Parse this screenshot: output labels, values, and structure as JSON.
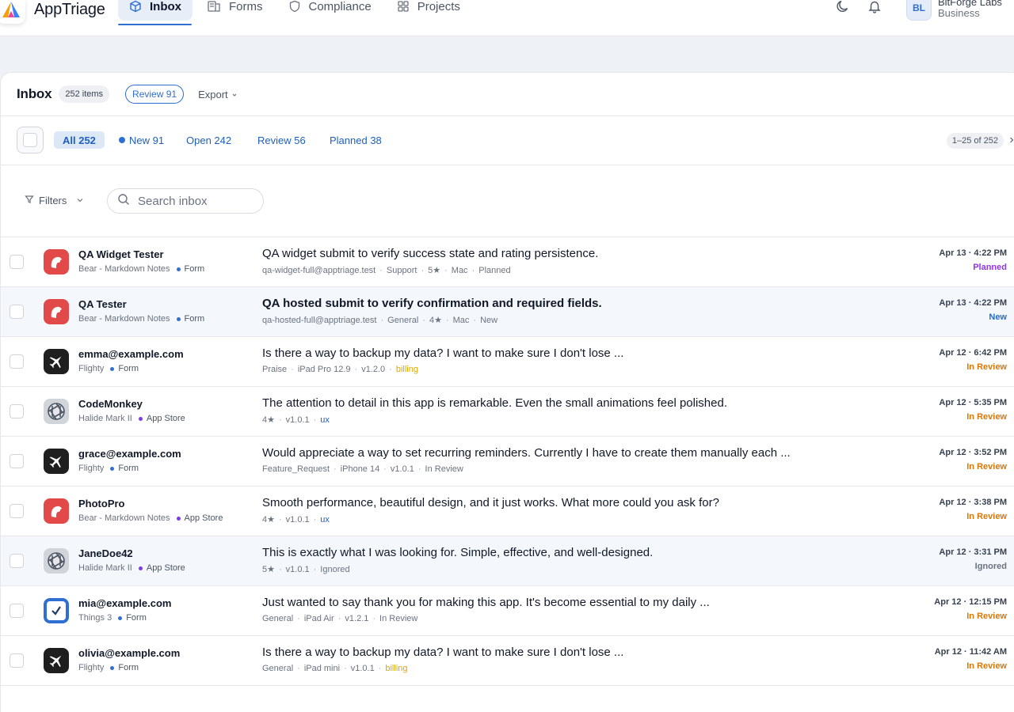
{
  "app": {
    "brand": "AppTriage"
  },
  "nav": {
    "items": [
      {
        "label": "Inbox",
        "icon": "inbox-icon",
        "active": true
      },
      {
        "label": "Forms",
        "icon": "forms-icon",
        "active": false
      },
      {
        "label": "Compliance",
        "icon": "shield-icon",
        "active": false
      },
      {
        "label": "Projects",
        "icon": "grid-icon",
        "active": false
      }
    ]
  },
  "account": {
    "initials": "BL",
    "org_name": "BitForge Labs",
    "plan": "Business"
  },
  "inbox": {
    "title": "Inbox",
    "count_badge": "252 items",
    "review_button": "Review 91",
    "export_label": "Export"
  },
  "tabs": [
    {
      "label": "All 252",
      "active": true,
      "dot": false
    },
    {
      "label": "New 91",
      "active": false,
      "dot": true
    },
    {
      "label": "Open 242",
      "active": false,
      "dot": false
    },
    {
      "label": "Review 56",
      "active": false,
      "dot": false
    },
    {
      "label": "Planned 38",
      "active": false,
      "dot": false
    }
  ],
  "pager": {
    "range": "1–25 of 252"
  },
  "filters": {
    "label": "Filters",
    "search_placeholder": "Search inbox"
  },
  "colors": {
    "accent": "#2f6fd1",
    "status_planned": "#9333ea",
    "status_new": "#1f6fd1",
    "status_in_review": "#d97706",
    "status_ignored": "#6b7280",
    "source_form": "#2f6fd1",
    "source_app_store": "#7c3aed",
    "tag_billing": "#e0a800",
    "tag_ux": "#1f5fbf"
  },
  "rows": [
    {
      "name": "QA Widget Tester",
      "app": "Bear - Markdown Notes",
      "app_icon": "bear-icon",
      "source": "Form",
      "message": "QA widget submit to verify success state and rating persistence.",
      "bold": false,
      "meta": [
        "qa-widget-full@apptriage.test",
        "Support",
        "5★",
        "Mac",
        "Planned"
      ],
      "date": "Apr 13 · 4:22 PM",
      "status": "Planned"
    },
    {
      "name": "QA Tester",
      "app": "Bear - Markdown Notes",
      "app_icon": "bear-icon",
      "source": "Form",
      "message": "QA hosted submit to verify confirmation and required fields.",
      "bold": true,
      "meta": [
        "qa-hosted-full@apptriage.test",
        "General",
        "4★",
        "Mac",
        "New"
      ],
      "date": "Apr 13 · 4:22 PM",
      "status": "New"
    },
    {
      "name": "emma@example.com",
      "app": "Flighty",
      "app_icon": "plane-icon",
      "source": "Form",
      "message": "Is there a way to backup my data? I want to make sure I don't lose ...",
      "bold": false,
      "meta": [
        "Praise",
        "iPad Pro 12.9",
        "v1.2.0",
        "billing"
      ],
      "date": "Apr 12 · 6:42 PM",
      "status": "In Review"
    },
    {
      "name": "CodeMonkey",
      "app": "Halide Mark II",
      "app_icon": "aperture-icon",
      "source": "App Store",
      "message": "The attention to detail in this app is remarkable. Even the small animations feel polished.",
      "bold": false,
      "meta": [
        "4★",
        "v1.0.1",
        "ux"
      ],
      "date": "Apr 12 · 5:35 PM",
      "status": "In Review"
    },
    {
      "name": "grace@example.com",
      "app": "Flighty",
      "app_icon": "plane-icon",
      "source": "Form",
      "message": "Would appreciate a way to set recurring reminders. Currently I have to create them manually each ...",
      "bold": false,
      "meta": [
        "Feature_Request",
        "iPhone 14",
        "v1.0.1",
        "In Review"
      ],
      "date": "Apr 12 · 3:52 PM",
      "status": "In Review"
    },
    {
      "name": "PhotoPro",
      "app": "Bear - Markdown Notes",
      "app_icon": "bear-icon",
      "source": "App Store",
      "message": "Smooth performance, beautiful design, and it just works. What more could you ask for?",
      "bold": false,
      "meta": [
        "4★",
        "v1.0.1",
        "ux"
      ],
      "date": "Apr 12 · 3:38 PM",
      "status": "In Review"
    },
    {
      "name": "JaneDoe42",
      "app": "Halide Mark II",
      "app_icon": "aperture-icon",
      "source": "App Store",
      "message": "This is exactly what I was looking for. Simple, effective, and well-designed.",
      "bold": false,
      "meta": [
        "5★",
        "v1.0.1",
        "Ignored"
      ],
      "date": "Apr 12 · 3:31 PM",
      "status": "Ignored"
    },
    {
      "name": "mia@example.com",
      "app": "Things 3",
      "app_icon": "checkbox-icon",
      "source": "Form",
      "message": "Just wanted to say thank you for making this app. It's become essential to my daily ...",
      "bold": false,
      "meta": [
        "General",
        "iPad Air",
        "v1.2.1",
        "In Review"
      ],
      "date": "Apr 12 · 12:15 PM",
      "status": "In Review"
    },
    {
      "name": "olivia@example.com",
      "app": "Flighty",
      "app_icon": "plane-icon",
      "source": "Form",
      "message": "Is there a way to backup my data? I want to make sure I don't lose ...",
      "bold": false,
      "meta": [
        "General",
        "iPad mini",
        "v1.0.1",
        "billing"
      ],
      "date": "Apr 12 · 11:42 AM",
      "status": "In Review"
    }
  ]
}
